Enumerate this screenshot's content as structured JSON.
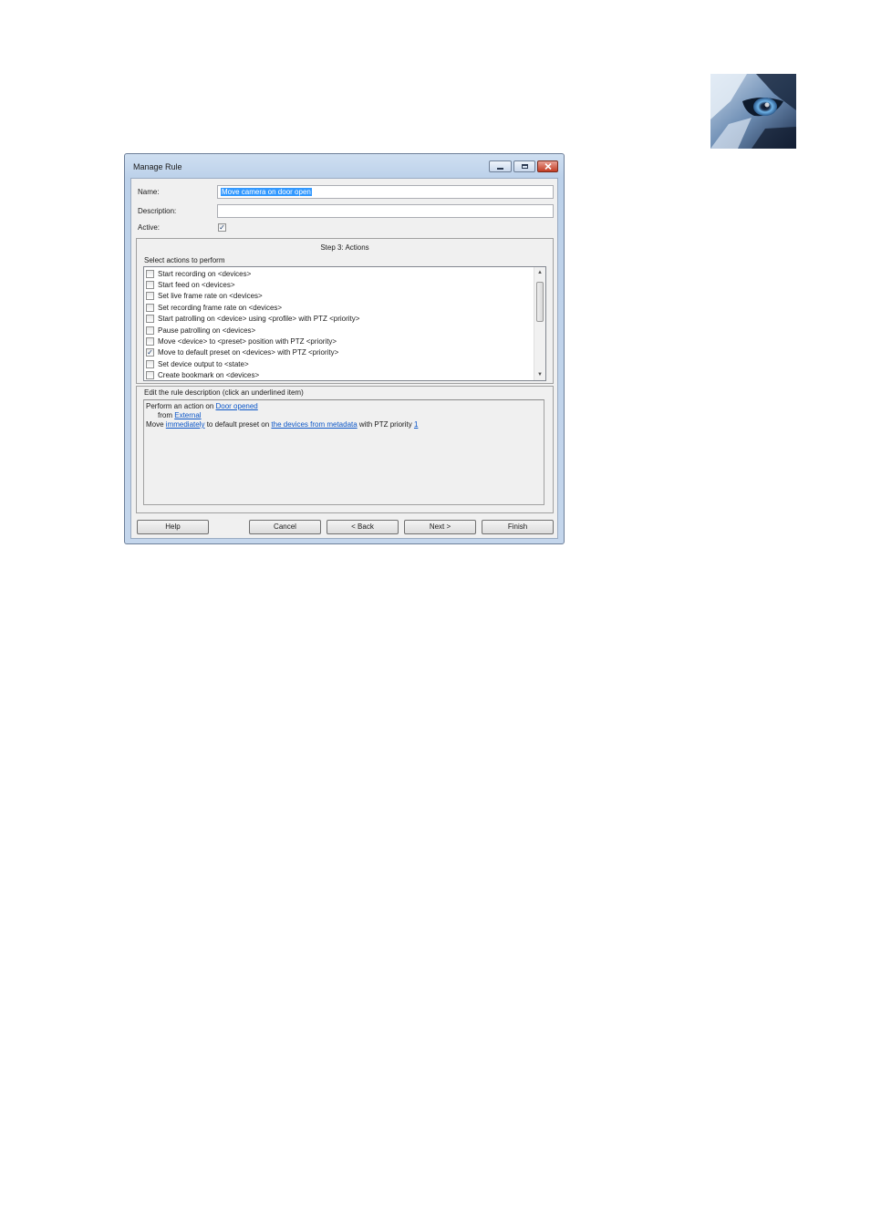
{
  "dialog": {
    "title": "Manage Rule",
    "name_label": "Name:",
    "name_value": "Move camera on door open",
    "description_label": "Description:",
    "description_value": "",
    "active_label": "Active:",
    "active_checked": true
  },
  "step": {
    "title": "Step 3: Actions",
    "select_label": "Select actions to perform",
    "actions": [
      {
        "label": "Start recording on <devices>",
        "checked": false
      },
      {
        "label": "Start feed on <devices>",
        "checked": false
      },
      {
        "label": "Set live frame rate on <devices>",
        "checked": false
      },
      {
        "label": "Set recording frame rate on <devices>",
        "checked": false
      },
      {
        "label": "Start patrolling on <device> using <profile> with PTZ <priority>",
        "checked": false
      },
      {
        "label": "Pause patrolling on <devices>",
        "checked": false
      },
      {
        "label": "Move <device> to <preset> position with PTZ <priority>",
        "checked": false
      },
      {
        "label": "Move to default preset on <devices> with PTZ <priority>",
        "checked": true
      },
      {
        "label": "Set device output to <state>",
        "checked": false
      },
      {
        "label": "Create bookmark on <devices>",
        "checked": false
      }
    ]
  },
  "rule_description": {
    "header": "Edit the rule description (click an underlined item)",
    "line1_prefix": "Perform an action on ",
    "line1_link": "Door opened",
    "line2_prefix": "from ",
    "line2_link": "External",
    "line3_a": "Move ",
    "line3_link1": "immediately",
    "line3_b": " to default preset on ",
    "line3_link2": "the devices from metadata",
    "line3_c": " with PTZ priority ",
    "line3_link3": "1"
  },
  "buttons": {
    "help": "Help",
    "cancel": "Cancel",
    "back": "< Back",
    "next": "Next >",
    "finish": "Finish"
  },
  "colors": {
    "title_bar": "#bcd1ea",
    "link": "#0b56c8",
    "selection": "#3399ff"
  }
}
